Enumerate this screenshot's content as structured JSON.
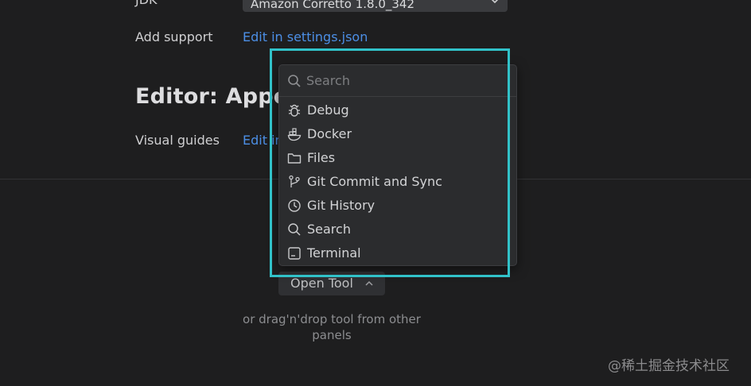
{
  "settings": {
    "jdk_label": "JDK",
    "jdk_value": "Amazon Corretto 1.8.0_342",
    "add_support_label": "Add support",
    "add_support_link": "Edit in settings.json",
    "section_title": "Editor: Appea",
    "visual_guides_label": "Visual guides",
    "visual_guides_link": "Edit in"
  },
  "popup": {
    "search_placeholder": "Search",
    "items": [
      {
        "label": "Debug",
        "icon": "bug-icon"
      },
      {
        "label": "Docker",
        "icon": "docker-icon"
      },
      {
        "label": "Files",
        "icon": "folder-icon"
      },
      {
        "label": "Git Commit and Sync",
        "icon": "git-branch-icon"
      },
      {
        "label": "Git History",
        "icon": "clock-icon"
      },
      {
        "label": "Search",
        "icon": "search-icon"
      },
      {
        "label": "Terminal",
        "icon": "terminal-icon"
      }
    ]
  },
  "tool_area": {
    "open_tool_label": "Open Tool",
    "hint": "or drag'n'drop tool from other panels"
  },
  "watermark": "@稀土掘金技术社区",
  "colors": {
    "background": "#1e1e1f",
    "link": "#4c8fe6",
    "highlight": "#31c2c9",
    "popup_bg": "#2b2c2e"
  }
}
